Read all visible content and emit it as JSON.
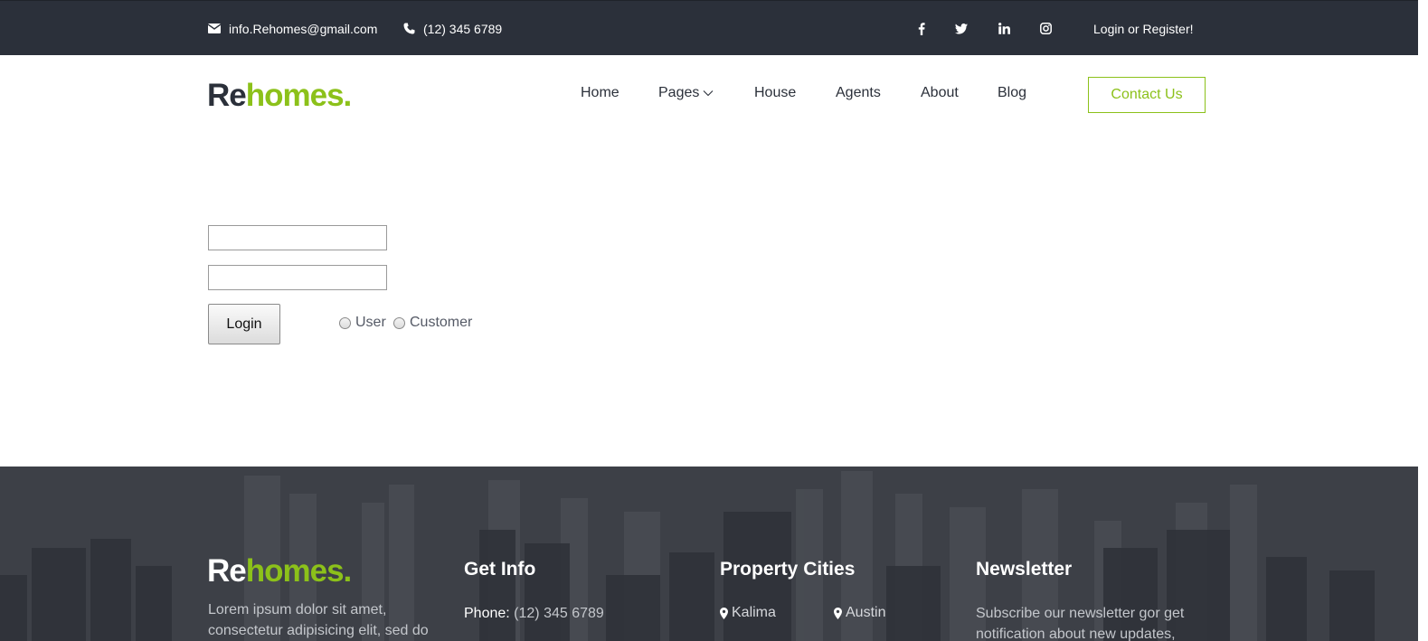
{
  "topbar": {
    "email": "info.Rehomes@gmail.com",
    "phone": "(12) 345 6789",
    "email_icon": "envelope-icon",
    "phone_icon": "phone-icon",
    "social": [
      {
        "name": "facebook-icon",
        "glyph": "f"
      },
      {
        "name": "twitter-icon",
        "glyph": "t"
      },
      {
        "name": "linkedin-icon",
        "glyph": "in"
      },
      {
        "name": "instagram-icon",
        "glyph": "ig"
      }
    ],
    "login": "Login or Register!"
  },
  "header": {
    "logo_re": "Re",
    "logo_homes": "homes.",
    "nav": [
      "Home",
      "Pages",
      "House",
      "Agents",
      "About",
      "Blog"
    ],
    "contact": "Contact Us"
  },
  "form": {
    "username_value": "",
    "password_value": "",
    "login_label": "Login",
    "roles": [
      "User",
      "Customer"
    ]
  },
  "footer": {
    "logo_re": "Re",
    "logo_homes": "homes.",
    "about_text_1": "Lorem ipsum dolor sit amet,",
    "about_text_2": "consectetur adipisicing elit, sed do",
    "get_info_title": "Get Info",
    "phone_label": "Phone:",
    "phone_value": "(12) 345 6789",
    "cities_title": "Property Cities",
    "cities": [
      "Kalima",
      "Austin"
    ],
    "newsletter_title": "Newsletter",
    "newsletter_text_1": "Subscribe our newsletter gor get",
    "newsletter_text_2": "notification about new updates,"
  },
  "colors": {
    "topbar_bg": "#2b303a",
    "accent_green": "#8cc11a",
    "footer_bg": "#3d4047"
  }
}
